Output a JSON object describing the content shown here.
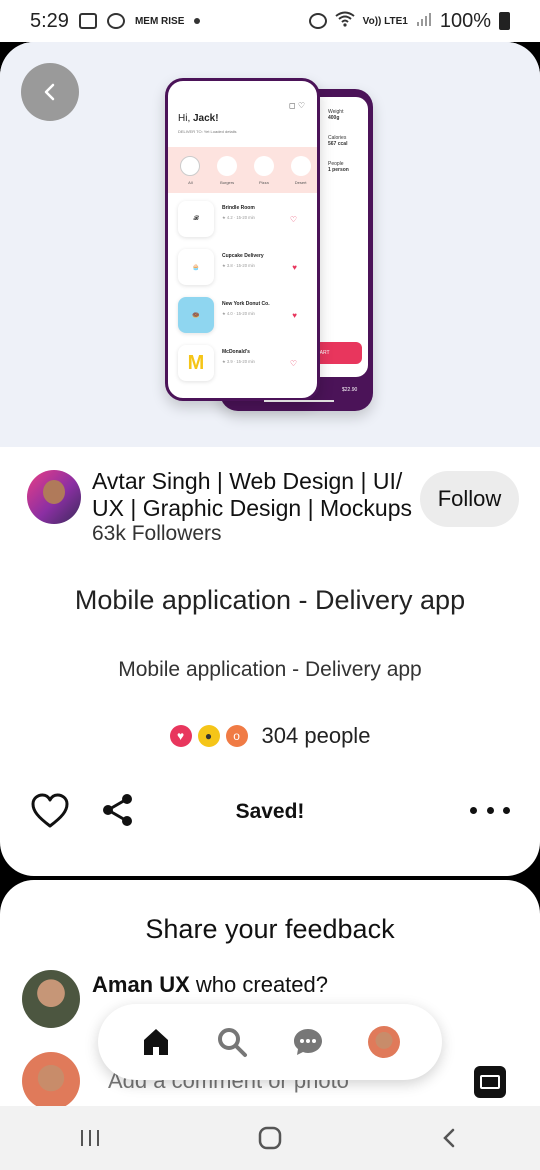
{
  "status_bar": {
    "time": "5:29",
    "battery": "100%",
    "icons": [
      "image-icon",
      "alarm-icon",
      "memrise-icon",
      "dot-icon",
      "clock-alarm-icon",
      "wifi-icon",
      "volte-icon",
      "signal-icon",
      "battery-icon"
    ],
    "memrise_label": "MEM RISE",
    "volte_label": "Vo)) LTE1"
  },
  "hero_mockup": {
    "greeting_prefix": "Hi, ",
    "greeting_name": "Jack!",
    "deliver_to": "DELIVER TO: Yet Loaded details",
    "categories": [
      "All",
      "Burgers",
      "Pizza",
      "Desert"
    ],
    "restaurants": [
      {
        "name": "Brindle Room",
        "rating": "4.2",
        "time": "15-20 min"
      },
      {
        "name": "Cupcake Delivery",
        "rating": "3.8",
        "time": "15-20 min"
      },
      {
        "name": "New York Donut Co.",
        "rating": "4.0",
        "time": "15-20 min"
      },
      {
        "name": "McDonald's",
        "rating": "3.9",
        "time": "15-20 min"
      }
    ],
    "back_screen": {
      "weight_label": "Weight",
      "weight_value": "400g",
      "calories_label": "Calories",
      "calories_value": "567 ccal",
      "people_label": "People",
      "people_value": "1 person",
      "cart_label": "CART",
      "price": "$22.90"
    }
  },
  "author": {
    "name": "Avtar Singh | Web Design | UI/ UX | Graphic Design | Mockups",
    "followers": "63k Followers",
    "follow_label": "Follow"
  },
  "pin": {
    "title": "Mobile application - Delivery app",
    "description": "Mobile application - Delivery app",
    "reaction_count": "304 people",
    "saved_label": "Saved!"
  },
  "feedback": {
    "title": "Share your feedback",
    "comment_author": "Aman UX",
    "comment_text": " who created?",
    "input_placeholder": "Add a comment or photo"
  },
  "colors": {
    "accent_pink": "#e8365d",
    "mockup_purple": "#4b1358",
    "hero_bg": "#eef1f8"
  }
}
